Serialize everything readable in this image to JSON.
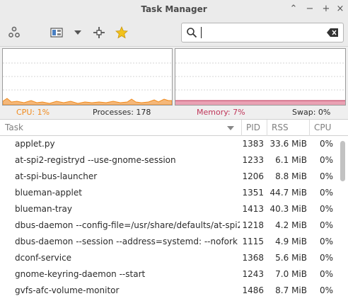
{
  "window": {
    "title": "Task Manager",
    "controls": {
      "restore": "⌃",
      "minimize": "−",
      "maximize": "+",
      "close": "×"
    }
  },
  "toolbar": {
    "icons": [
      "settings-gear-icon",
      "view-columns-icon",
      "dropdown-arrow-icon",
      "crosshair-icon",
      "favorite-star-icon"
    ],
    "search": {
      "value": "",
      "placeholder": ""
    }
  },
  "stats": {
    "cpu_label": "CPU: 1%",
    "processes_label": "Processes: 178",
    "memory_label": "Memory: 7%",
    "swap_label": "Swap: 0%",
    "cpu_color": "#f08a1c",
    "memory_color": "#c0365a"
  },
  "columns": {
    "task": "Task",
    "pid": "PID",
    "rss": "RSS",
    "cpu": "CPU"
  },
  "processes": [
    {
      "task": "applet.py",
      "pid": "1383",
      "rss": "33.6 MiB",
      "cpu": "0%"
    },
    {
      "task": "at-spi2-registryd --use-gnome-session",
      "pid": "1233",
      "rss": "6.1 MiB",
      "cpu": "0%"
    },
    {
      "task": "at-spi-bus-launcher",
      "pid": "1206",
      "rss": "8.8 MiB",
      "cpu": "0%"
    },
    {
      "task": "blueman-applet",
      "pid": "1351",
      "rss": "44.7 MiB",
      "cpu": "0%"
    },
    {
      "task": "blueman-tray",
      "pid": "1413",
      "rss": "40.3 MiB",
      "cpu": "0%"
    },
    {
      "task": "dbus-daemon --config-file=/usr/share/defaults/at-spi2/...",
      "pid": "1218",
      "rss": "4.2 MiB",
      "cpu": "0%"
    },
    {
      "task": "dbus-daemon --session --address=systemd: --nofork --...",
      "pid": "1115",
      "rss": "4.9 MiB",
      "cpu": "0%"
    },
    {
      "task": "dconf-service",
      "pid": "1368",
      "rss": "5.6 MiB",
      "cpu": "0%"
    },
    {
      "task": "gnome-keyring-daemon --start",
      "pid": "1243",
      "rss": "7.0 MiB",
      "cpu": "0%"
    },
    {
      "task": "gvfs-afc-volume-monitor",
      "pid": "1486",
      "rss": "8.7 MiB",
      "cpu": "0%"
    }
  ]
}
